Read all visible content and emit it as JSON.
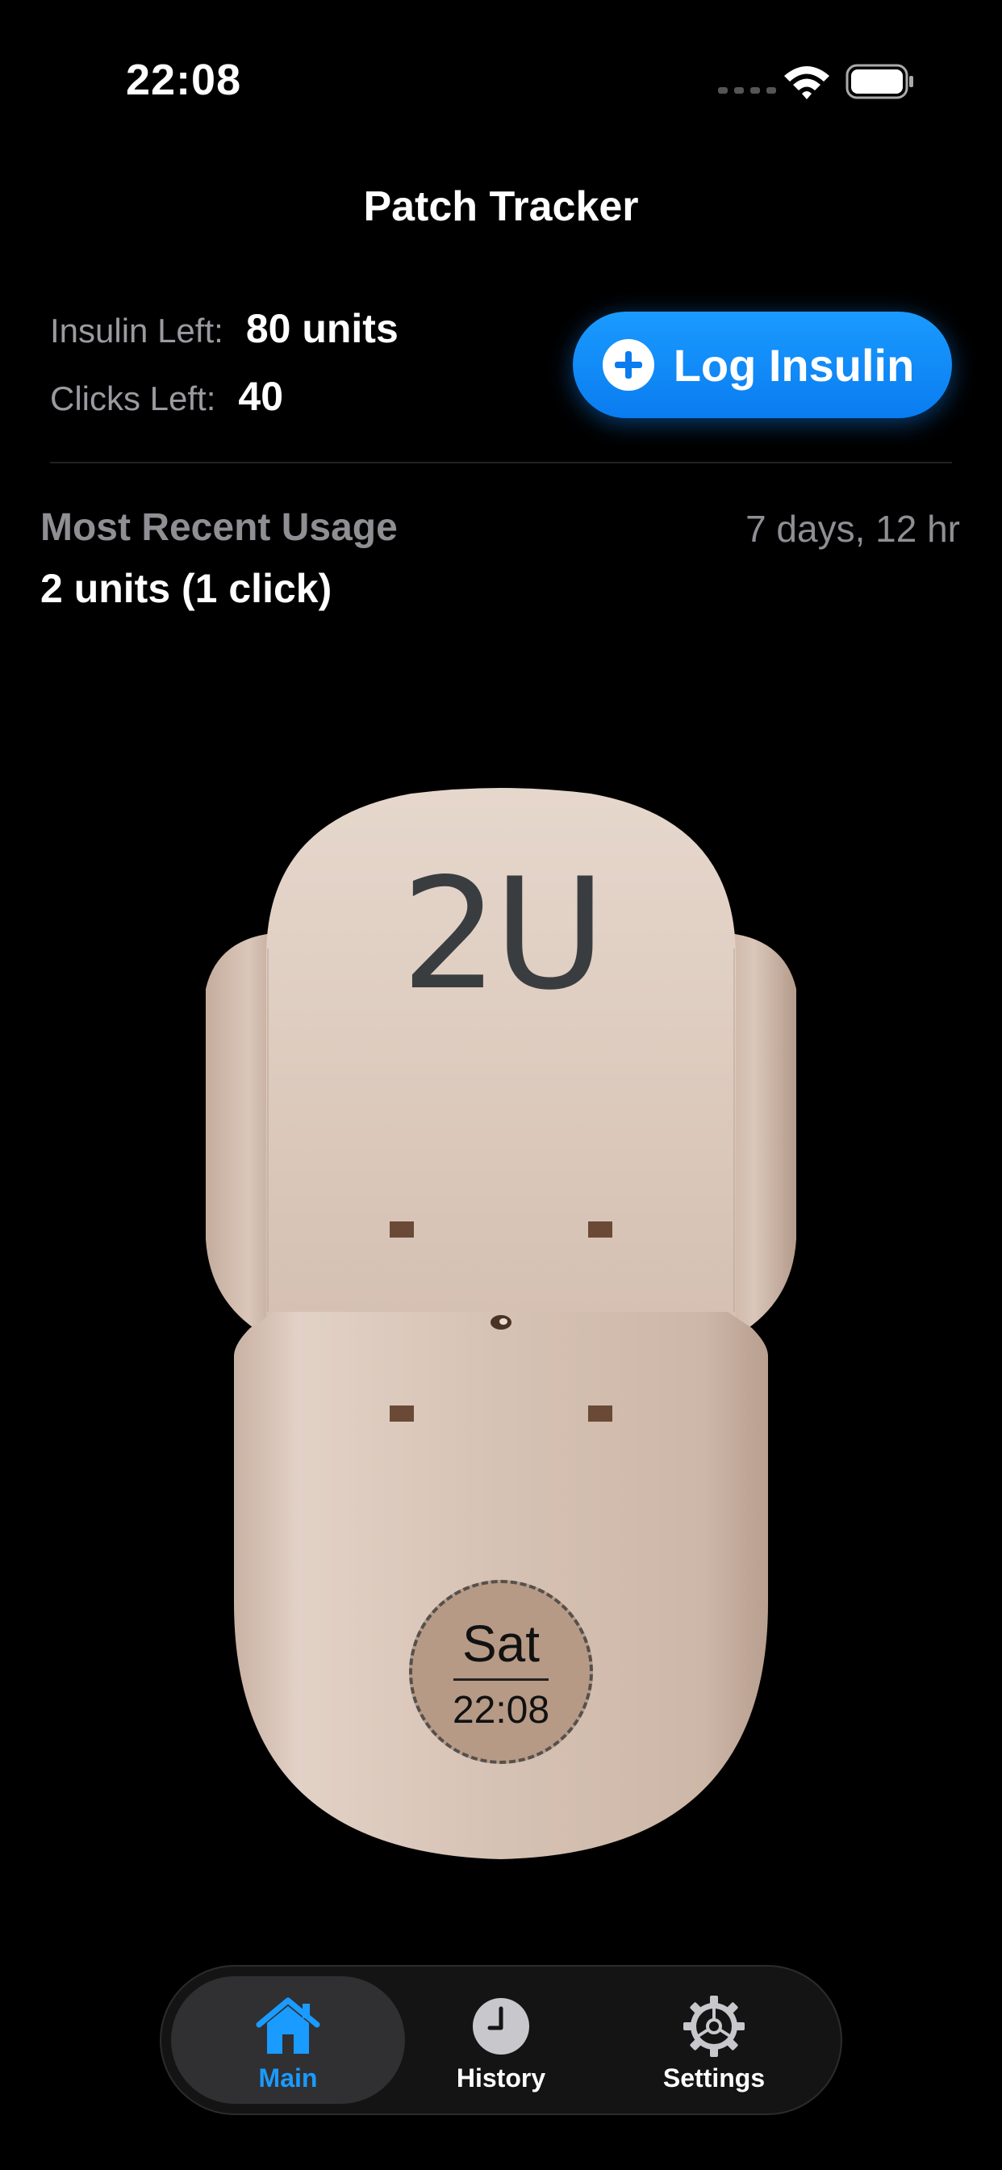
{
  "status_bar": {
    "time": "22:08",
    "icons": [
      "cellular-dots-icon",
      "wifi-icon",
      "battery-icon"
    ]
  },
  "nav": {
    "title": "Patch Tracker"
  },
  "stats": {
    "insulin_label": "Insulin Left:",
    "insulin_value": "80 units",
    "clicks_label": "Clicks Left:",
    "clicks_value": "40"
  },
  "log_button": {
    "label": "Log Insulin",
    "icon": "plus-circle-icon"
  },
  "recent": {
    "title": "Most Recent Usage",
    "age": "7 days, 12 hr",
    "value": "2 units (1 click)"
  },
  "device": {
    "dose": "2U",
    "day": "Sat",
    "time": "22:08"
  },
  "tabs": [
    {
      "label": "Main",
      "icon": "house-icon",
      "active": true
    },
    {
      "label": "History",
      "icon": "clock-icon",
      "active": false
    },
    {
      "label": "Settings",
      "icon": "gear-icon",
      "active": false
    }
  ],
  "colors": {
    "accent": "#0a84ff",
    "background": "#000000",
    "secondary_text": "#8e8e93",
    "device_body": "#d8c3b4",
    "device_clock": "#b69a86"
  }
}
